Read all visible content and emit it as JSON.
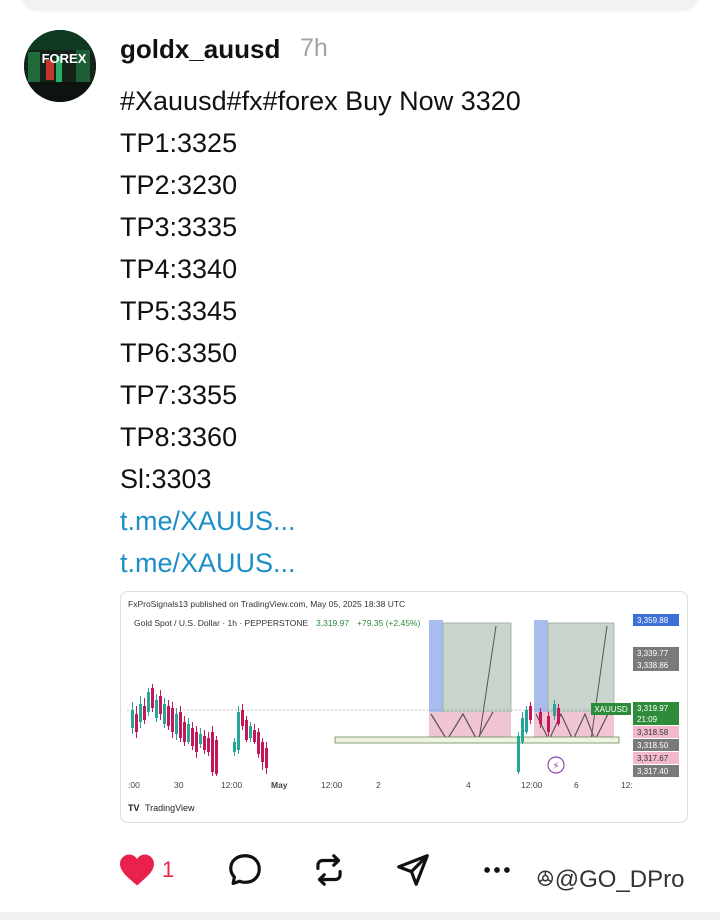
{
  "post": {
    "username": "goldx_auusd",
    "time": "7h",
    "lines": [
      "#Xauusd#fx#forex Buy Now 3320",
      "TP1:3325",
      "TP2:3230",
      "TP3:3335",
      "TP4:3340",
      "TP5:3345",
      "TP6:3350",
      "TP7:3355",
      "TP8:3360",
      "Sl:3303"
    ],
    "links": [
      "t.me/XAUUS...",
      "t.me/XAUUS..."
    ],
    "avatar_text": "FOREX",
    "likes": "1"
  },
  "icons": {
    "like": "heart-icon",
    "comment": "comment-icon",
    "repost": "repost-icon",
    "share": "send-icon",
    "more": "more-icon"
  },
  "watermark": "@GO_DPro",
  "colors": {
    "like": "#e8224a",
    "link": "#1c8ec8",
    "up": "#26a69a",
    "down": "#c2185b",
    "price_green": "#2e8b3a",
    "highlight_blue": "#3d6fd9"
  },
  "chart_data": {
    "type": "candlestick",
    "published_line": "FxProSignals13 published on TradingView.com, May 05, 2025 18:38 UTC",
    "symbol_line": "Gold Spot / U.S. Dollar · 1h · PEPPERSTONE",
    "last_price": "3,319.97",
    "change": "+79.35 (+2.45%)",
    "x_tick_labels": [
      ":00",
      "30",
      "12:00",
      "May",
      "12:00",
      "2",
      "4",
      "12:00",
      "6",
      "12:"
    ],
    "price_labels": [
      "3,359.88",
      "3,339.77",
      "3,338.86",
      "3,319.97",
      "21:09",
      "3,318.58",
      "3,318.50",
      "3,317.67",
      "3,317.40"
    ],
    "symbol_tag": "XAUUSD",
    "brand": "TradingView"
  }
}
